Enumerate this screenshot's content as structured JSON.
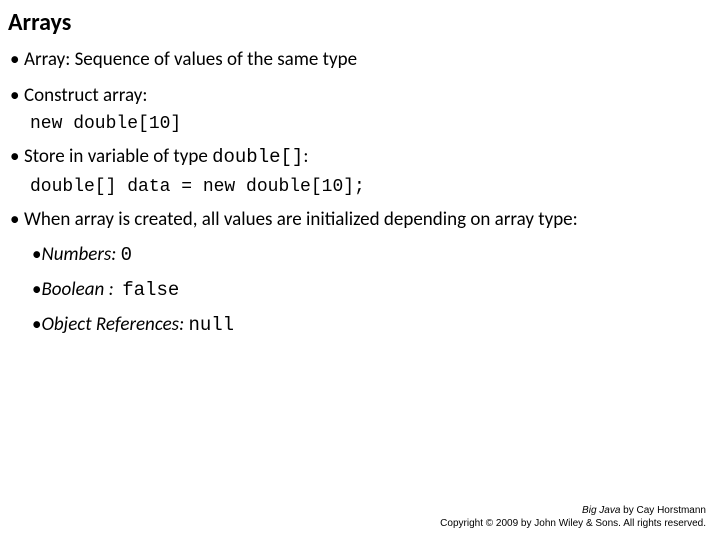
{
  "title": "Arrays",
  "b1": {
    "text": "Array: Sequence of values of the same type"
  },
  "b2": {
    "text": "Construct array:",
    "code": "new double[10]"
  },
  "b3": {
    "prefix": "Store in variable of type ",
    "inline_code": "double[]",
    "suffix": ":",
    "code": "double[] data = new double[10];"
  },
  "b4": {
    "text": "When array is created, all values are initialized depending on array type:"
  },
  "inner": {
    "numbers": {
      "label": "Numbers:",
      "value": "0"
    },
    "boolean": {
      "label": "Boolean :",
      "value": "false"
    },
    "objref": {
      "label": "Object References:",
      "value": "null"
    }
  },
  "footer": {
    "book": "Big Java",
    "by": " by Cay Horstmann",
    "copyright": "Copyright © 2009 by John Wiley & Sons. All rights reserved."
  },
  "dot": "•"
}
